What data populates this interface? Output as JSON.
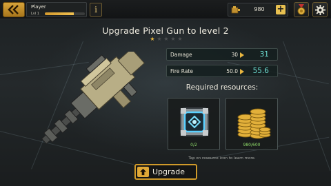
{
  "top_bar": {
    "back_icon": "double-chevron-left-icon",
    "player_name": "Player",
    "player_level": "Lvl 1",
    "xp_progress": 0.72,
    "info_label": "i",
    "coins_icon": "gun-tank-icon",
    "coins_value": "980",
    "plus_label": "+",
    "medal_icon": "medal-icon",
    "settings_icon": "gear-icon"
  },
  "upgrade": {
    "title": "Upgrade Pixel Gun to level 2",
    "stars_filled": 1,
    "stars_total": 5,
    "stats": [
      {
        "label": "Damage",
        "current": "30",
        "next": "31"
      },
      {
        "label": "Fire Rate",
        "current": "50.0",
        "next": "55.6"
      }
    ],
    "required_title": "Required resources:",
    "resources": [
      {
        "name": "crate",
        "icon": "supply-crate-icon",
        "count": "0/2"
      },
      {
        "name": "coins",
        "icon": "coin-stack-icon",
        "count": "980/600"
      }
    ],
    "hint": "Tap on resource icon to learn more.",
    "button_label": "Upgrade",
    "button_icon": "upgrade-arrow-icon"
  },
  "colors": {
    "accent": "#d09a2a",
    "stat_new": "#6ee0d4",
    "count_ok": "#8fdc6a"
  }
}
